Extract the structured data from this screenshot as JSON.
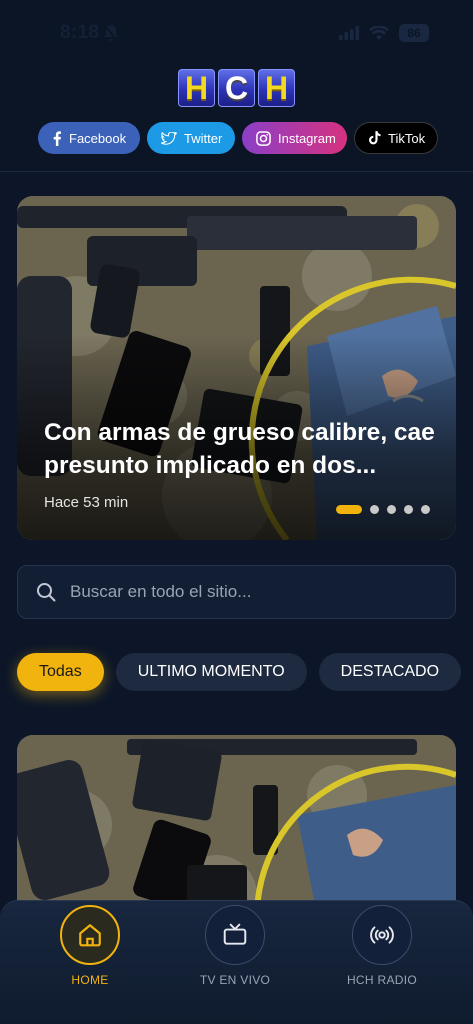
{
  "status_bar": {
    "time": "8:18",
    "battery": "86"
  },
  "header": {
    "logo": [
      "H",
      "C",
      "H"
    ],
    "social": [
      {
        "label": "Facebook",
        "icon": "facebook-icon"
      },
      {
        "label": "Twitter",
        "icon": "twitter-icon"
      },
      {
        "label": "Instagram",
        "icon": "instagram-icon"
      },
      {
        "label": "TikTok",
        "icon": "tiktok-icon"
      }
    ]
  },
  "hero": {
    "title": "Con armas de grueso calibre, cae presunto implicado en dos...",
    "time": "Hace 53 min",
    "slides": 5,
    "active_slide": 1,
    "watermark": "HCH"
  },
  "search": {
    "placeholder": "Buscar en todo el sitio..."
  },
  "chips": [
    "Todas",
    "ULTIMO MOMENTO",
    "DESTACADO"
  ],
  "bottom_nav": [
    {
      "label": "HOME",
      "icon": "home-icon",
      "active": true
    },
    {
      "label": "TV EN VIVO",
      "icon": "tv-icon",
      "active": false
    },
    {
      "label": "HCH RADIO",
      "icon": "radio-icon",
      "active": false
    }
  ],
  "colors": {
    "accent": "#f1b30e",
    "background": "#0c1628",
    "facebook": "#3b62b8",
    "twitter": "#1d9ae6"
  }
}
